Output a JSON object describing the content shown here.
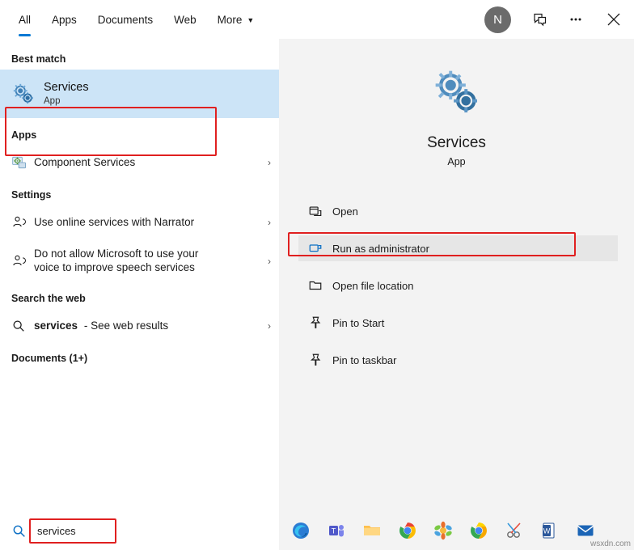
{
  "topnav": {
    "tabs": [
      {
        "label": "All",
        "active": true,
        "caret": false
      },
      {
        "label": "Apps",
        "active": false,
        "caret": false
      },
      {
        "label": "Documents",
        "active": false,
        "caret": false
      },
      {
        "label": "Web",
        "active": false,
        "caret": false
      },
      {
        "label": "More",
        "active": false,
        "caret": true
      }
    ],
    "avatar_initial": "N",
    "feedback_icon": "feedback-icon",
    "more_icon": "ellipsis-icon",
    "close_icon": "close-icon"
  },
  "left": {
    "best_match_header": "Best match",
    "best_match": {
      "title": "Services",
      "subtitle": "App",
      "icon": "services-gears-icon"
    },
    "apps_header": "Apps",
    "apps": [
      {
        "label": "Component Services",
        "icon": "component-services-icon",
        "chevron": "›"
      }
    ],
    "settings_header": "Settings",
    "settings": [
      {
        "line1": "Use online services with Narrator",
        "bold_word": "services",
        "icon": "settings-person-icon",
        "chevron": "›"
      },
      {
        "line1": "Do not allow Microsoft to use your",
        "line2": "voice to improve speech services",
        "bold_word": "services",
        "icon": "settings-person-icon",
        "chevron": "›"
      }
    ],
    "web_header": "Search the web",
    "web": [
      {
        "query": "services",
        "suffix": "- See web results",
        "icon": "search-icon",
        "chevron": "›"
      }
    ],
    "documents_header": "Documents (1+)"
  },
  "right": {
    "app_title": "Services",
    "app_type": "App",
    "hero_icon": "services-gears-icon",
    "actions": [
      {
        "label": "Open",
        "icon": "open-window-icon",
        "highlighted": false
      },
      {
        "label": "Run as administrator",
        "icon": "shield-run-icon",
        "highlighted": true
      },
      {
        "label": "Open file location",
        "icon": "folder-icon",
        "highlighted": false
      },
      {
        "label": "Pin to Start",
        "icon": "pin-icon",
        "highlighted": false
      },
      {
        "label": "Pin to taskbar",
        "icon": "pin-icon",
        "highlighted": false
      }
    ]
  },
  "taskbar": {
    "search_value": "services",
    "search_icon": "search-magnifier-icon",
    "apps": [
      {
        "name": "edge-icon"
      },
      {
        "name": "teams-icon"
      },
      {
        "name": "file-explorer-icon"
      },
      {
        "name": "chrome-icon"
      },
      {
        "name": "photos-icon"
      },
      {
        "name": "chrome-canary-icon"
      },
      {
        "name": "snip-sketch-icon"
      },
      {
        "name": "word-icon"
      },
      {
        "name": "mail-icon"
      }
    ],
    "watermark": "wsxdn.com"
  },
  "colors": {
    "accent": "#0078d4",
    "highlight_box": "#e02020",
    "selection": "#cce4f7",
    "right_pane_bg": "#f3f3f3"
  }
}
